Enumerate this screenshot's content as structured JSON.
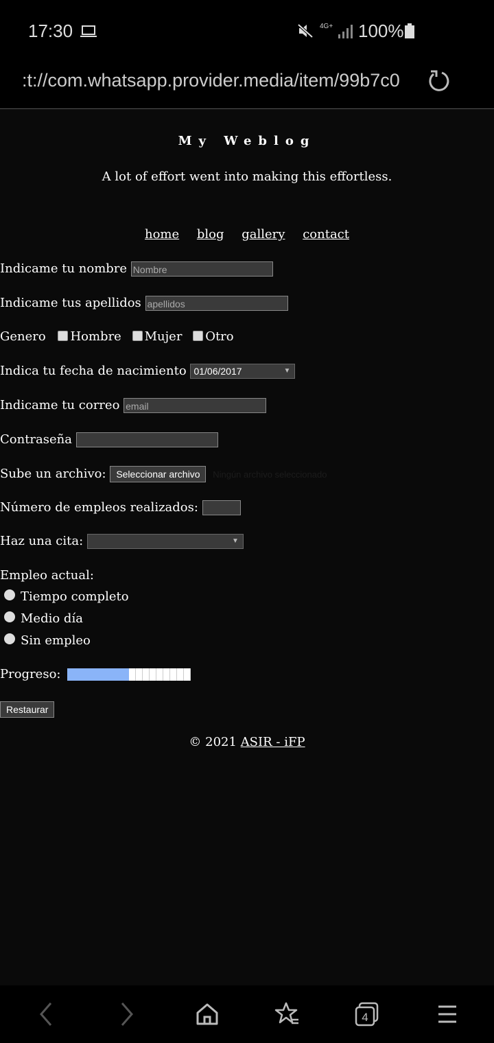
{
  "status_bar": {
    "time": "17:30",
    "network": "4G+",
    "battery": "100%"
  },
  "browser": {
    "url": ":t://com.whatsapp.provider.media/item/99b7c0",
    "tab_count": "4"
  },
  "site": {
    "title": "My Weblog",
    "tagline": "A lot of effort went into making this effortless."
  },
  "nav": [
    {
      "label": "home"
    },
    {
      "label": "blog"
    },
    {
      "label": "gallery"
    },
    {
      "label": "contact"
    }
  ],
  "form": {
    "nombre": {
      "label": "Indicame tu nombre",
      "placeholder": "Nombre"
    },
    "apellidos": {
      "label": "Indicame tus apellidos",
      "placeholder": "apellidos"
    },
    "genero": {
      "label": "Genero",
      "options": [
        "Hombre",
        "Mujer",
        "Otro"
      ]
    },
    "fecha": {
      "label": "Indica tu fecha de nacimiento",
      "value": "01/06/2017"
    },
    "correo": {
      "label": "Indicame tu correo",
      "placeholder": "email"
    },
    "password": {
      "label": "Contraseña"
    },
    "archivo": {
      "label": "Sube un archivo:",
      "button": "Seleccionar archivo",
      "status": "Ningún archivo seleccionado"
    },
    "empleos": {
      "label": "Número de empleos realizados:"
    },
    "cita": {
      "label": "Haz una cita:"
    },
    "empleo_actual": {
      "label": "Empleo actual:",
      "options": [
        "Tiempo completo",
        "Medio día",
        "Sin empleo"
      ]
    },
    "progreso": {
      "label": "Progreso:",
      "value": 0.5
    },
    "reset": "Restaurar"
  },
  "footer": {
    "copyright": "© 2021",
    "link": "ASIR - iFP"
  },
  "colors": {
    "background": "#0a0a0a",
    "progress_fill": "#8ab4f8"
  }
}
